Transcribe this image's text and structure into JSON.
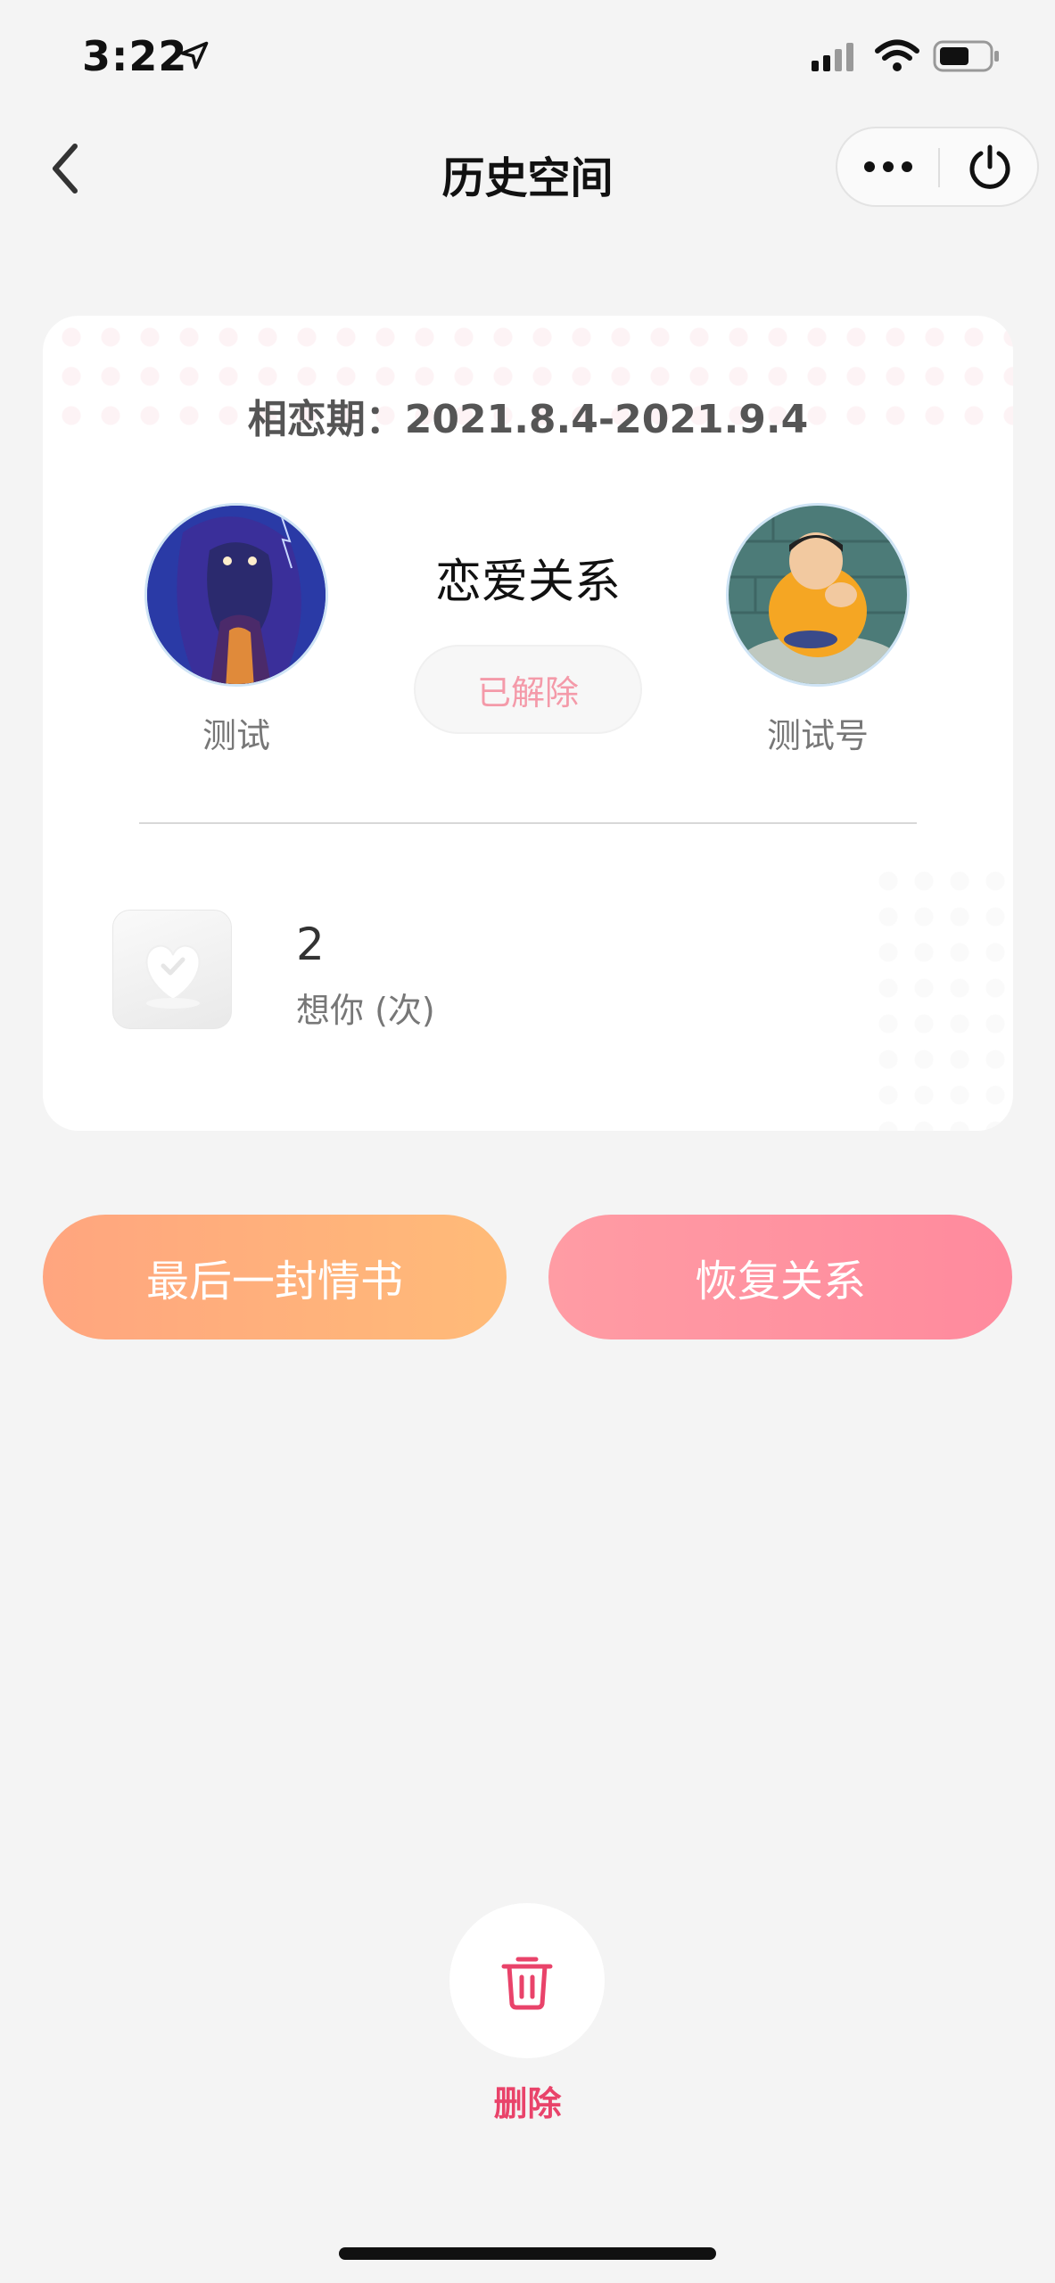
{
  "status_bar": {
    "time": "3:22"
  },
  "nav": {
    "title": "历史空间"
  },
  "card": {
    "period_label": "相恋期：",
    "period_value": "2021.8.4-2021.9.4",
    "left_person": {
      "name": "测试",
      "avatar": "avatar-fantasy-cave"
    },
    "right_person": {
      "name": "测试号",
      "avatar": "avatar-cartoon-boy"
    },
    "relation_title": "恋爱关系",
    "relation_status": "已解除",
    "stat": {
      "value": "2",
      "label": "想你 (次)",
      "icon": "heart-stamp-icon"
    }
  },
  "actions": {
    "last_letter": "最后一封情书",
    "restore": "恢复关系"
  },
  "delete": {
    "label": "删除",
    "icon": "trash-icon"
  },
  "colors": {
    "accent_pink": "#e9436a",
    "status_pink": "#f49aa9",
    "orange_gradient_start": "#ffa57f",
    "orange_gradient_end": "#ffbb78",
    "pink_gradient_start": "#ff9ca4",
    "pink_gradient_end": "#ff8a9d",
    "background": "#f4f4f4"
  }
}
